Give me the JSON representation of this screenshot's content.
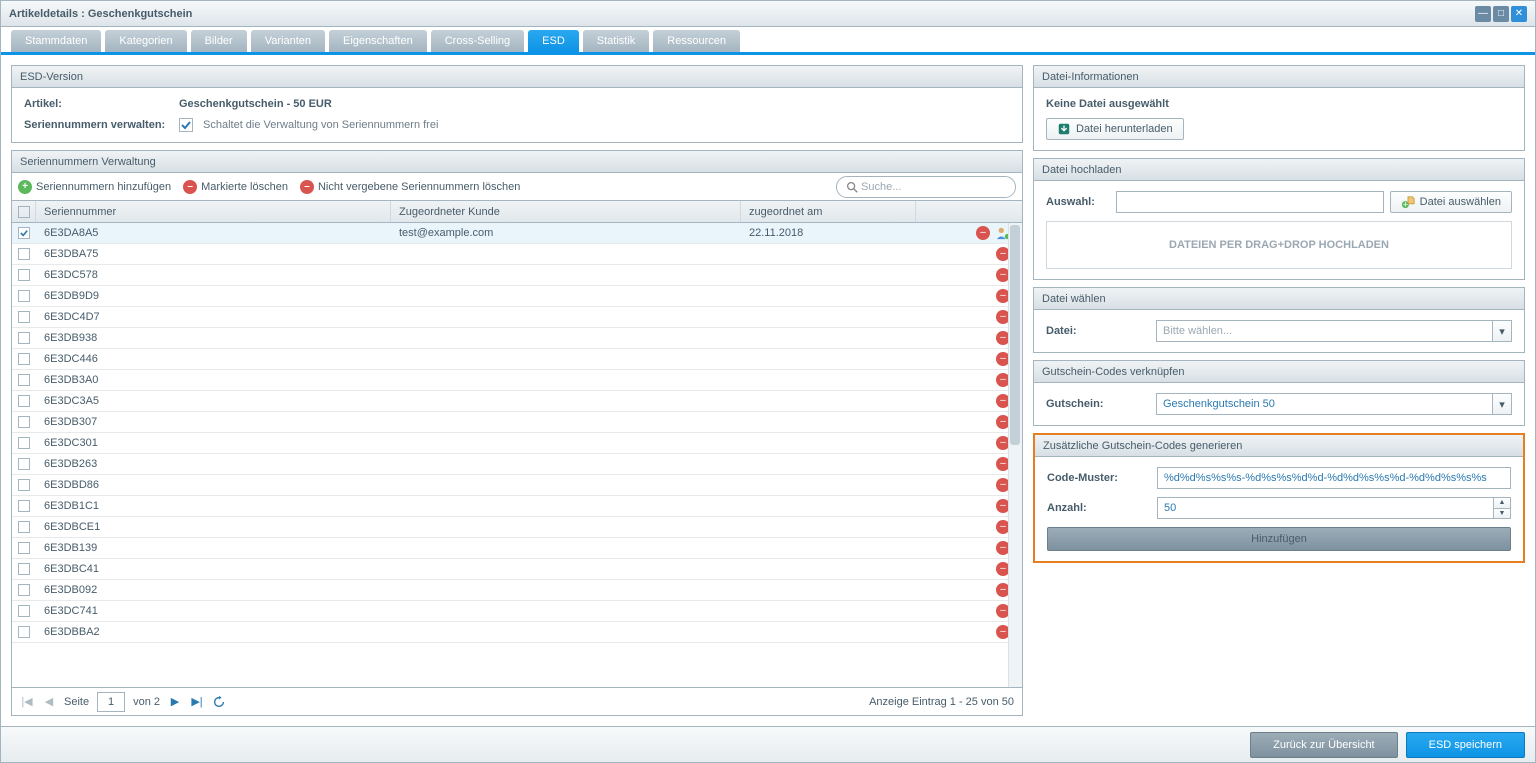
{
  "window": {
    "title": "Artikeldetails : Geschenkgutschein"
  },
  "tabs": [
    {
      "label": "Stammdaten",
      "active": false
    },
    {
      "label": "Kategorien",
      "active": false
    },
    {
      "label": "Bilder",
      "active": false
    },
    {
      "label": "Varianten",
      "active": false
    },
    {
      "label": "Eigenschaften",
      "active": false
    },
    {
      "label": "Cross-Selling",
      "active": false
    },
    {
      "label": "ESD",
      "active": true
    },
    {
      "label": "Statistik",
      "active": false
    },
    {
      "label": "Ressourcen",
      "active": false
    }
  ],
  "esd_version": {
    "title": "ESD-Version",
    "article_label": "Artikel:",
    "article_value": "Geschenkgutschein - 50 EUR",
    "serial_label": "Seriennummern verwalten:",
    "serial_checked": true,
    "serial_hint": "Schaltet die Verwaltung von Seriennummern frei"
  },
  "serial_mgmt": {
    "title": "Seriennummern Verwaltung",
    "add_label": "Seriennummern hinzufügen",
    "del_marked_label": "Markierte löschen",
    "del_unassigned_label": "Nicht vergebene Seriennummern löschen",
    "search_placeholder": "Suche...",
    "col_serial": "Seriennummer",
    "col_customer": "Zugeordneter Kunde",
    "col_assigned": "zugeordnet am",
    "rows": [
      {
        "serial": "6E3DA8A5",
        "customer": "test@example.com",
        "assigned": "22.11.2018",
        "checked": true,
        "hasUser": true
      },
      {
        "serial": "6E3DBA75",
        "customer": "",
        "assigned": "",
        "checked": false
      },
      {
        "serial": "6E3DC578",
        "customer": "",
        "assigned": "",
        "checked": false
      },
      {
        "serial": "6E3DB9D9",
        "customer": "",
        "assigned": "",
        "checked": false
      },
      {
        "serial": "6E3DC4D7",
        "customer": "",
        "assigned": "",
        "checked": false
      },
      {
        "serial": "6E3DB938",
        "customer": "",
        "assigned": "",
        "checked": false
      },
      {
        "serial": "6E3DC446",
        "customer": "",
        "assigned": "",
        "checked": false
      },
      {
        "serial": "6E3DB3A0",
        "customer": "",
        "assigned": "",
        "checked": false
      },
      {
        "serial": "6E3DC3A5",
        "customer": "",
        "assigned": "",
        "checked": false
      },
      {
        "serial": "6E3DB307",
        "customer": "",
        "assigned": "",
        "checked": false
      },
      {
        "serial": "6E3DC301",
        "customer": "",
        "assigned": "",
        "checked": false
      },
      {
        "serial": "6E3DB263",
        "customer": "",
        "assigned": "",
        "checked": false
      },
      {
        "serial": "6E3DBD86",
        "customer": "",
        "assigned": "",
        "checked": false
      },
      {
        "serial": "6E3DB1C1",
        "customer": "",
        "assigned": "",
        "checked": false
      },
      {
        "serial": "6E3DBCE1",
        "customer": "",
        "assigned": "",
        "checked": false
      },
      {
        "serial": "6E3DB139",
        "customer": "",
        "assigned": "",
        "checked": false
      },
      {
        "serial": "6E3DBC41",
        "customer": "",
        "assigned": "",
        "checked": false
      },
      {
        "serial": "6E3DB092",
        "customer": "",
        "assigned": "",
        "checked": false
      },
      {
        "serial": "6E3DC741",
        "customer": "",
        "assigned": "",
        "checked": false
      },
      {
        "serial": "6E3DBBA2",
        "customer": "",
        "assigned": "",
        "checked": false
      }
    ],
    "pager": {
      "page_label": "Seite",
      "current": "1",
      "of_label": "von 2",
      "summary": "Anzeige Eintrag 1 - 25 von 50"
    }
  },
  "file_info": {
    "title": "Datei-Informationen",
    "none": "Keine Datei ausgewählt",
    "download": "Datei herunterladen"
  },
  "file_upload": {
    "title": "Datei hochladen",
    "select_label": "Auswahl:",
    "select_btn": "Datei auswählen",
    "dropzone": "DATEIEN PER DRAG+DROP HOCHLADEN"
  },
  "file_choose": {
    "title": "Datei wählen",
    "label": "Datei:",
    "placeholder": "Bitte wählen..."
  },
  "voucher_link": {
    "title": "Gutschein-Codes verknüpfen",
    "label": "Gutschein:",
    "value": "Geschenkgutschein 50"
  },
  "voucher_gen": {
    "title": "Zusätzliche Gutschein-Codes generieren",
    "pattern_label": "Code-Muster:",
    "pattern_value": "%d%d%s%s%s-%d%s%s%d%d-%d%d%s%s%d-%d%d%s%s%s",
    "count_label": "Anzahl:",
    "count_value": "50",
    "add_btn": "Hinzufügen"
  },
  "footer": {
    "back": "Zurück zur Übersicht",
    "save": "ESD speichern"
  }
}
